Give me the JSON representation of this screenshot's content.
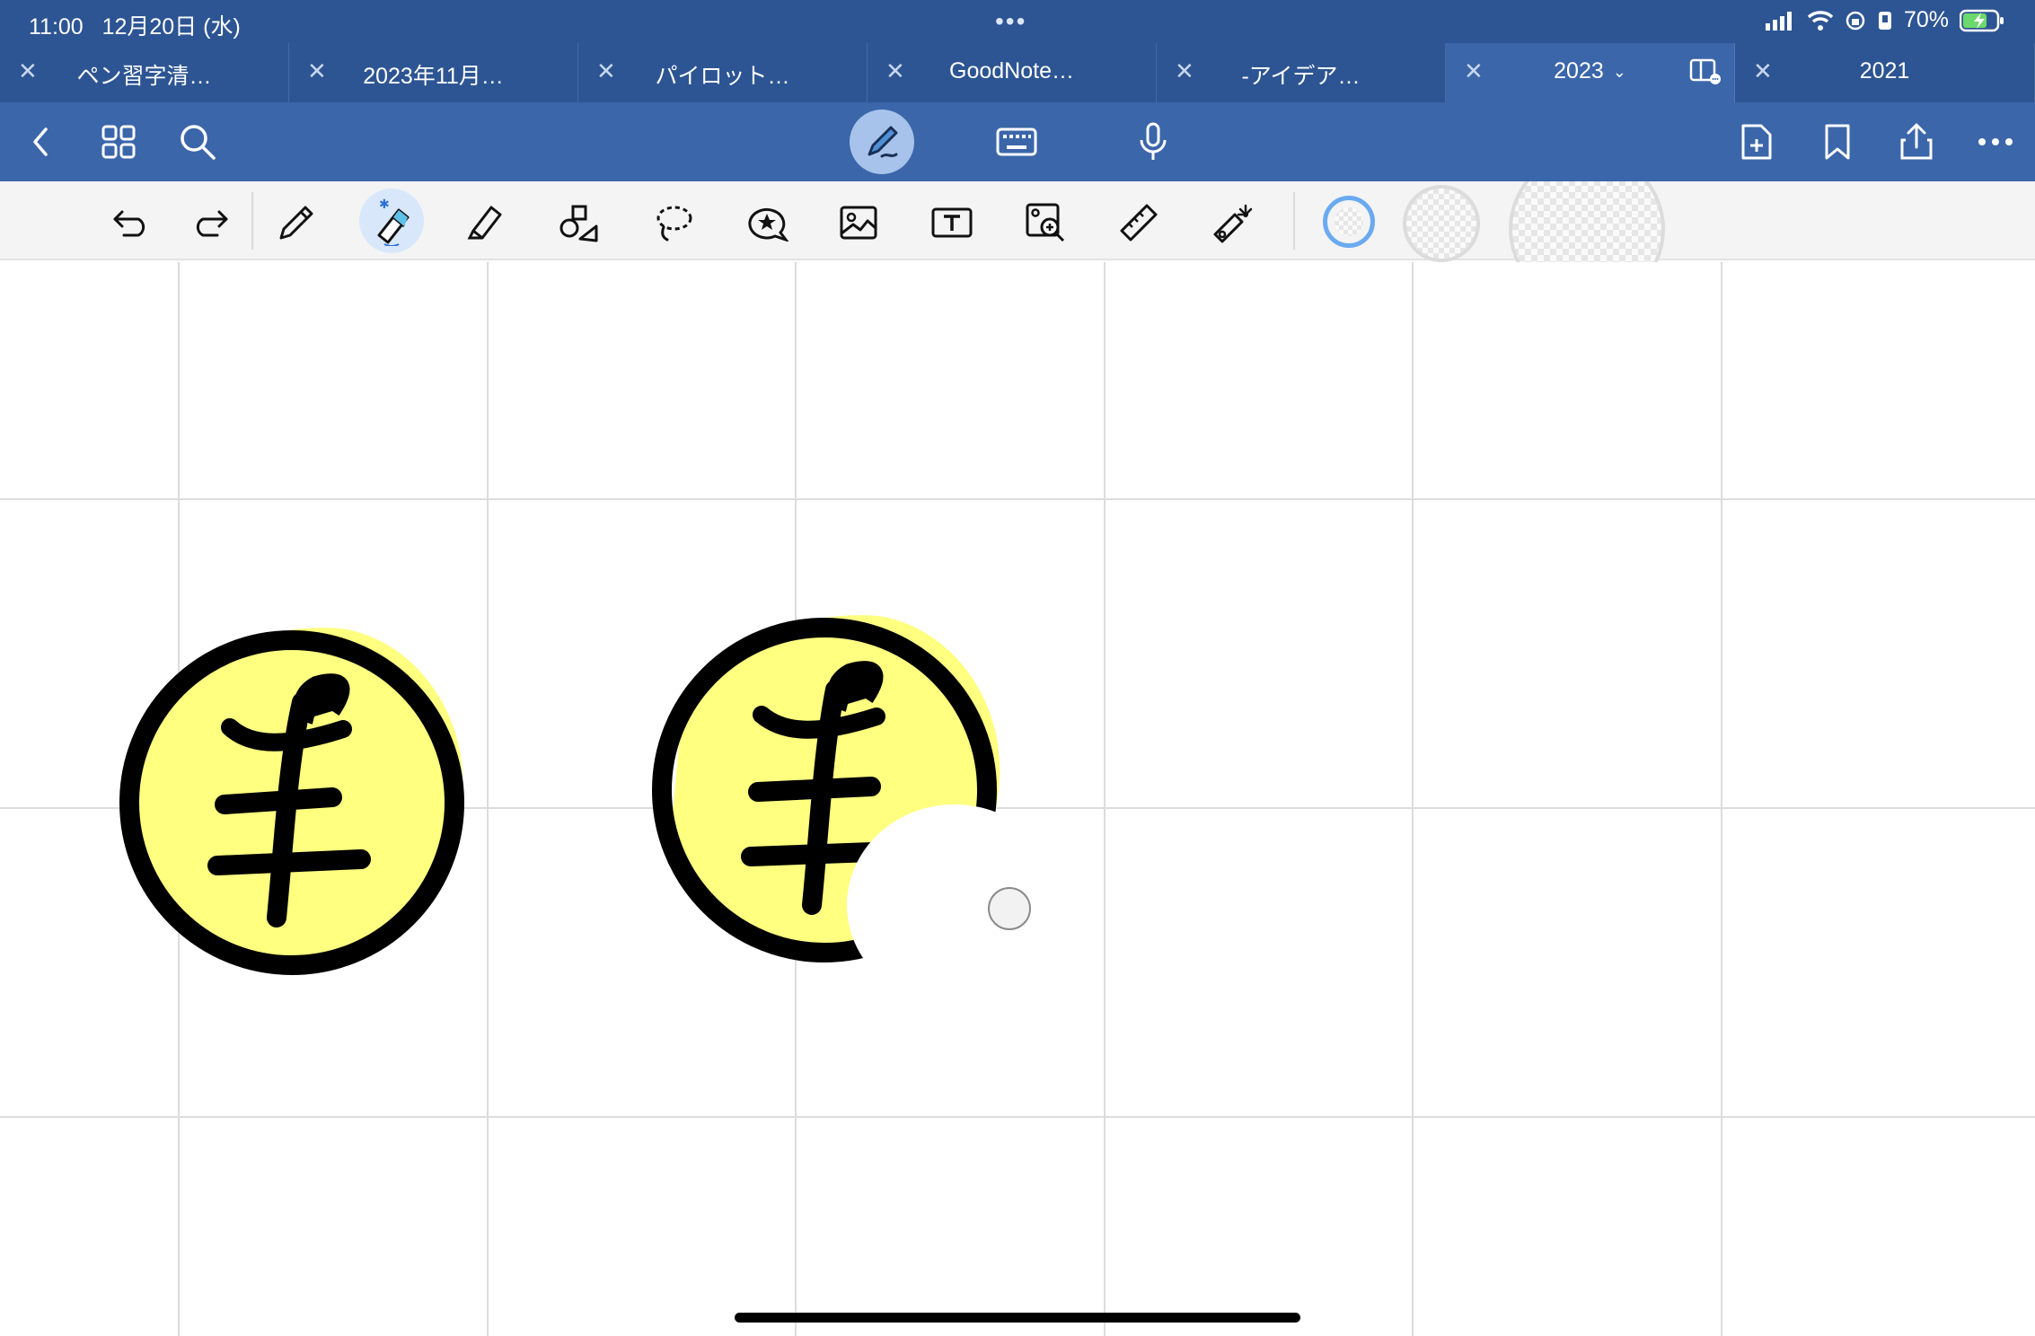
{
  "status_bar": {
    "time": "11:00",
    "date": "12月20日 (水)",
    "center_dots": "•••",
    "battery_pct": "70%"
  },
  "tabs": [
    {
      "label": "ペン習字清…",
      "active": false
    },
    {
      "label": "2023年11月…",
      "active": false
    },
    {
      "label": "パイロット…",
      "active": false
    },
    {
      "label": "GoodNote…",
      "active": false
    },
    {
      "label": "-アイデア…",
      "active": false
    },
    {
      "label": "2023",
      "active": true
    },
    {
      "label": "2021",
      "active": false
    }
  ],
  "toolbar": {
    "left_icons": [
      "back-icon",
      "grid-icon",
      "search-icon"
    ],
    "center_icons": [
      "pen-mode-icon",
      "keyboard-icon",
      "microphone-icon"
    ],
    "right_icons": [
      "add-page-icon",
      "bookmark-icon",
      "share-icon",
      "more-icon"
    ]
  },
  "tools": {
    "items": [
      "undo-icon",
      "redo-icon",
      "pen-icon",
      "eraser-icon",
      "highlighter-icon",
      "shapes-icon",
      "lasso-icon",
      "sticker-icon",
      "image-icon",
      "text-box-icon",
      "image-zoom-icon",
      "ruler-icon",
      "laser-pointer-icon"
    ],
    "selected": "eraser-icon",
    "size_options": [
      "small",
      "medium",
      "large"
    ],
    "selected_size": "small"
  },
  "colors": {
    "topbar": "#2d5593",
    "toolbar": "#3b66aa",
    "highlight_yellow": "#ffff80",
    "ink": "#000000",
    "accent_blue": "#6aaaf0"
  },
  "canvas": {
    "grid": true,
    "drawing_char": "手"
  }
}
